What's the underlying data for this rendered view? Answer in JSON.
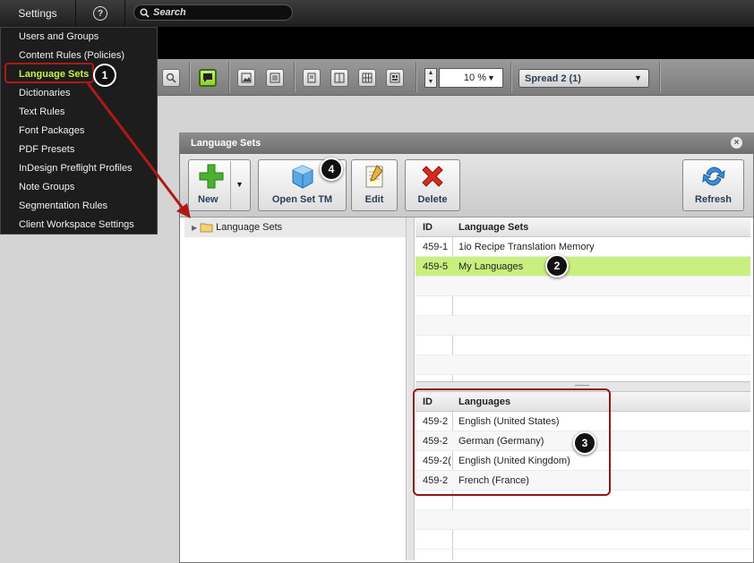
{
  "topbar": {
    "settings_label": "Settings",
    "help_label": "?",
    "search_placeholder": "Search"
  },
  "settings_menu": {
    "items": [
      {
        "label": "Users and Groups",
        "active": false
      },
      {
        "label": "Content Rules (Policies)",
        "active": false
      },
      {
        "label": "Language Sets",
        "active": true
      },
      {
        "label": "Dictionaries",
        "active": false
      },
      {
        "label": "Text Rules",
        "active": false
      },
      {
        "label": "Font Packages",
        "active": false
      },
      {
        "label": "PDF Presets",
        "active": false
      },
      {
        "label": "InDesign Preflight Profiles",
        "active": false
      },
      {
        "label": "Note Groups",
        "active": false
      },
      {
        "label": "Segmentation Rules",
        "active": false
      },
      {
        "label": "Client Workspace Settings",
        "active": false
      }
    ]
  },
  "main_toolbar": {
    "zoom_value": "10 %",
    "spread_value": "Spread 2 (1)"
  },
  "dialog": {
    "title": "Language Sets",
    "buttons": {
      "new": "New",
      "open_set_tm": "Open Set TM",
      "edit": "Edit",
      "delete": "Delete",
      "refresh": "Refresh"
    },
    "tree": {
      "root_label": "Language Sets"
    },
    "sets_grid": {
      "headers": {
        "id": "ID",
        "name": "Language Sets"
      },
      "rows": [
        {
          "id": "459-1",
          "name": "1io Recipe Translation Memory",
          "selected": false
        },
        {
          "id": "459-5",
          "name": "My Languages",
          "selected": true
        }
      ]
    },
    "languages_grid": {
      "headers": {
        "id": "ID",
        "name": "Languages"
      },
      "rows": [
        {
          "id": "459-2",
          "name": "English (United States)"
        },
        {
          "id": "459-2",
          "name": "German (Germany)"
        },
        {
          "id": "459-2(",
          "name": "English (United Kingdom)"
        },
        {
          "id": "459-2",
          "name": "French (France)"
        }
      ]
    }
  },
  "callouts": {
    "one": "1",
    "two": "2",
    "three": "3",
    "four": "4"
  },
  "colors": {
    "selection_green": "#c9f07e",
    "active_menu": "#c8f04a",
    "callout_red": "#b01818"
  }
}
